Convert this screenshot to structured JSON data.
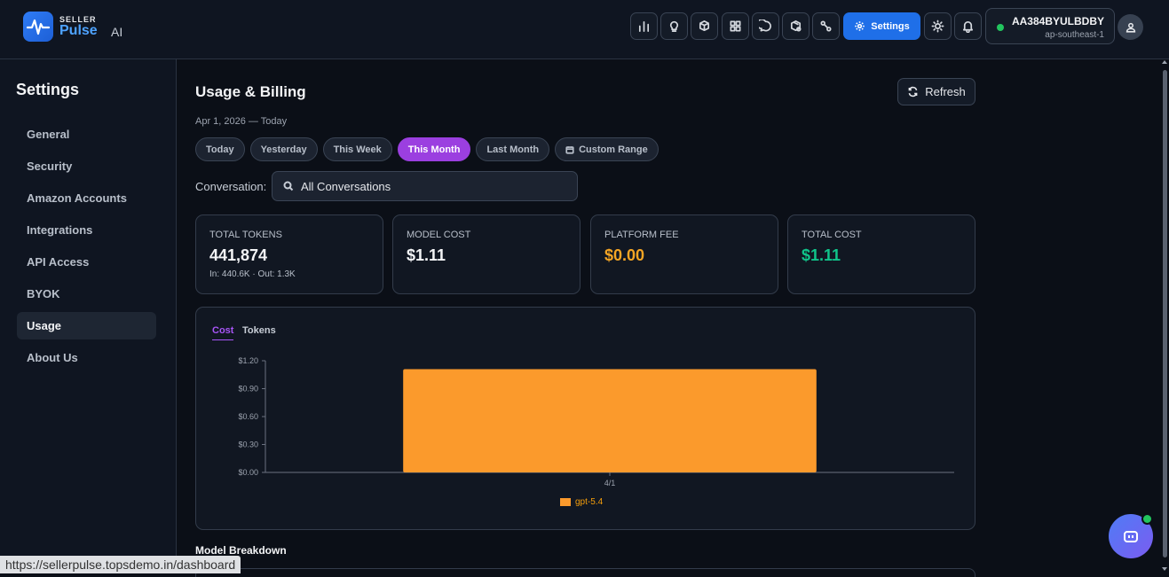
{
  "brand": {
    "top": "SELLER",
    "main": "Pulse",
    "suffix": "AI"
  },
  "header": {
    "settings_label": "Settings",
    "account_id": "AA384BYULBDBY",
    "account_region": "ap-southeast-1",
    "icons": [
      "bar-chart-icon",
      "lightbulb-icon",
      "box-icon",
      "grid-icon",
      "chat-icon",
      "package-icon",
      "workflow-icon",
      "sun-icon",
      "bell-icon",
      "user-icon"
    ]
  },
  "sidebar": {
    "title": "Settings",
    "items": [
      {
        "label": "General"
      },
      {
        "label": "Security"
      },
      {
        "label": "Amazon Accounts"
      },
      {
        "label": "Integrations"
      },
      {
        "label": "API Access"
      },
      {
        "label": "BYOK"
      },
      {
        "label": "Usage",
        "active": true
      },
      {
        "label": "About Us"
      }
    ]
  },
  "main": {
    "title": "Usage & Billing",
    "refresh_label": "Refresh",
    "date_range": "Apr 1, 2026 — Today",
    "ranges": [
      "Today",
      "Yesterday",
      "This Week",
      "This Month",
      "Last Month",
      "Custom Range"
    ],
    "active_range": "This Month",
    "conversation_label": "Conversation:",
    "conversation_value": "All Conversations",
    "cards": {
      "tokens": {
        "label": "TOTAL TOKENS",
        "value": "441,874",
        "sub": "In: 440.6K · Out: 1.3K"
      },
      "model": {
        "label": "MODEL COST",
        "value": "$1.11"
      },
      "platform": {
        "label": "PLATFORM FEE",
        "value": "$0.00"
      },
      "total": {
        "label": "TOTAL COST",
        "value": "$1.11"
      }
    },
    "chart_tabs": {
      "cost": "Cost",
      "tokens": "Tokens"
    },
    "breakdown_title": "Model Breakdown"
  },
  "colors": {
    "accent": "#9b3fe0",
    "primary": "#1f6fe8",
    "bar": "#fb9a2c",
    "fee": "#f5a524",
    "total": "#10c48a"
  },
  "chart_data": {
    "type": "bar",
    "categories": [
      "4/1"
    ],
    "series": [
      {
        "name": "gpt-5.4",
        "values": [
          1.11
        ]
      }
    ],
    "ylim": [
      0,
      1.2
    ],
    "yticks": [
      "$0.00",
      "$0.30",
      "$0.60",
      "$0.90",
      "$1.20"
    ],
    "yticks_values": [
      0,
      0.3,
      0.6,
      0.9,
      1.2
    ],
    "legend": "bottom",
    "grid": false
  },
  "status_url": "https://sellerpulse.topsdemo.in/dashboard"
}
